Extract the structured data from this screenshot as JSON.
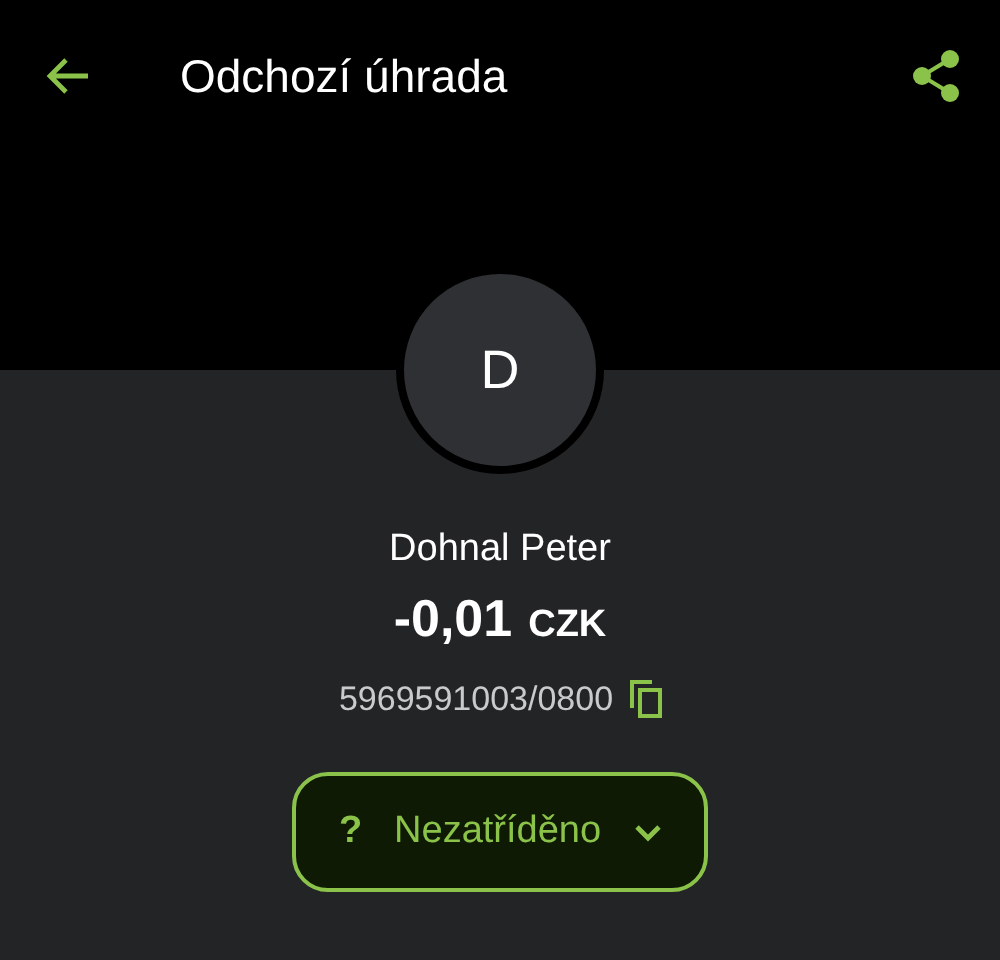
{
  "header": {
    "title": "Odchozí úhrada"
  },
  "avatar": {
    "initial": "D"
  },
  "counterparty": {
    "name": "Dohnal Peter",
    "amount": "-0,01",
    "currency": "CZK",
    "account": "5969591003/0800"
  },
  "category": {
    "symbol": "?",
    "label": "Nezatříděno"
  }
}
